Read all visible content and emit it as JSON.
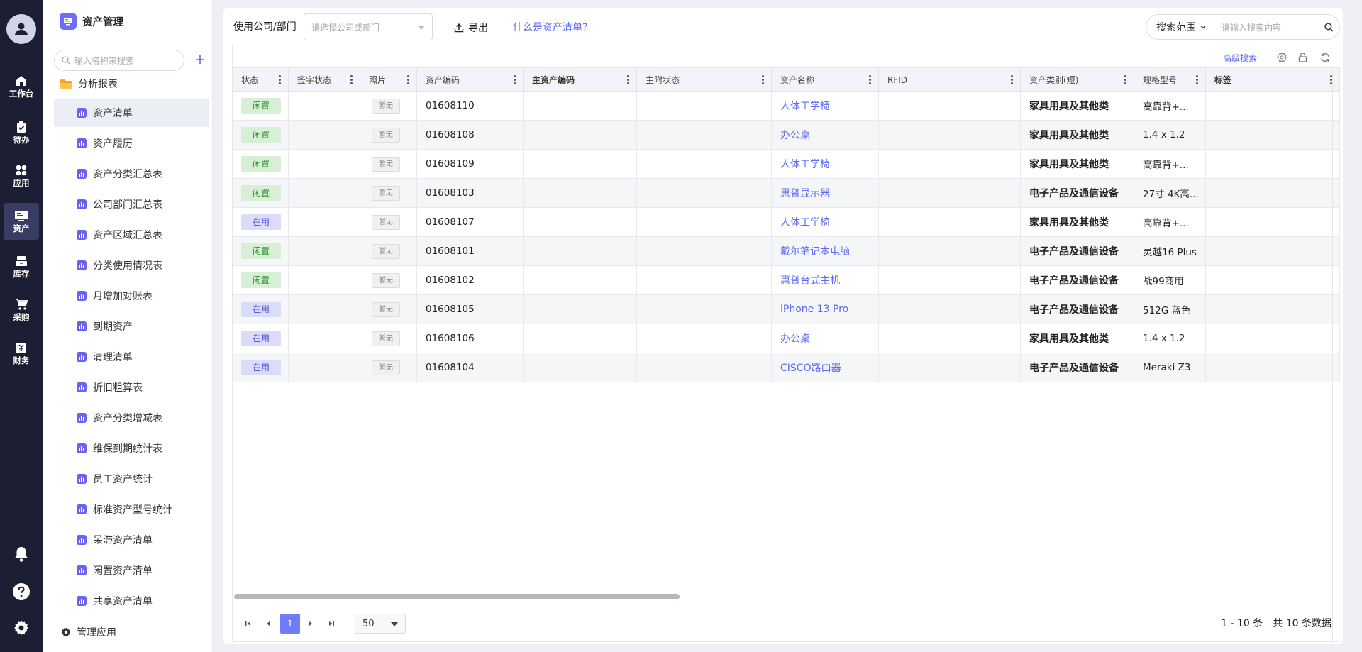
{
  "nav": {
    "items": [
      {
        "label": "工作台",
        "icon": "home-icon"
      },
      {
        "label": "待办",
        "icon": "clipboard-check-icon"
      },
      {
        "label": "应用",
        "icon": "grid-icon"
      },
      {
        "label": "资产",
        "icon": "asset-icon"
      },
      {
        "label": "库存",
        "icon": "inventory-icon"
      },
      {
        "label": "采购",
        "icon": "cart-icon"
      },
      {
        "label": "财务",
        "icon": "finance-icon"
      }
    ]
  },
  "sidebar": {
    "title": "资产管理",
    "search_placeholder": "输入名称来搜索",
    "folder": "分析报表",
    "items": [
      "资产清单",
      "资产履历",
      "资产分类汇总表",
      "公司部门汇总表",
      "资产区域汇总表",
      "分类使用情况表",
      "月增加对账表",
      "到期资产",
      "清理清单",
      "折旧粗算表",
      "资产分类增减表",
      "维保到期统计表",
      "员工资产统计",
      "标准资产型号统计",
      "呆滞资产清单",
      "闲置资产清单",
      "共享资产清单"
    ],
    "footer": "管理应用"
  },
  "filter": {
    "label": "使用公司/部门",
    "placeholder": "请选择公司或部门"
  },
  "export_label": "导出",
  "help_link": "什么是资产清单?",
  "search": {
    "scope": "搜索范围",
    "placeholder": "请输入搜索内容"
  },
  "toolbar": {
    "advanced_search": "高级搜索"
  },
  "table": {
    "columns": [
      "状态",
      "签字状态",
      "照片",
      "资产编码",
      "主资产编码",
      "主附状态",
      "资产名称",
      "RFID",
      "资产类别(短)",
      "规格型号",
      "标签"
    ],
    "rows": [
      {
        "status": "闲置",
        "photo": "暂无",
        "code": "01608110",
        "name": "人体工学椅",
        "category": "家具用具及其他类",
        "spec": "高靠背+..."
      },
      {
        "status": "闲置",
        "photo": "暂无",
        "code": "01608108",
        "name": "办公桌",
        "category": "家具用具及其他类",
        "spec": "1.4 x 1.2"
      },
      {
        "status": "闲置",
        "photo": "暂无",
        "code": "01608109",
        "name": "人体工学椅",
        "category": "家具用具及其他类",
        "spec": "高靠背+..."
      },
      {
        "status": "闲置",
        "photo": "暂无",
        "code": "01608103",
        "name": "惠普显示器",
        "category": "电子产品及通信设备",
        "spec": "27寸 4K高..."
      },
      {
        "status": "在用",
        "photo": "暂无",
        "code": "01608107",
        "name": "人体工学椅",
        "category": "家具用具及其他类",
        "spec": "高靠背+..."
      },
      {
        "status": "闲置",
        "photo": "暂无",
        "code": "01608101",
        "name": "戴尔笔记本电脑",
        "category": "电子产品及通信设备",
        "spec": "灵越16 Plus"
      },
      {
        "status": "闲置",
        "photo": "暂无",
        "code": "01608102",
        "name": "惠普台式主机",
        "category": "电子产品及通信设备",
        "spec": "战99商用"
      },
      {
        "status": "在用",
        "photo": "暂无",
        "code": "01608105",
        "name": "iPhone 13 Pro",
        "category": "电子产品及通信设备",
        "spec": "512G 蓝色"
      },
      {
        "status": "在用",
        "photo": "暂无",
        "code": "01608106",
        "name": "办公桌",
        "category": "家具用具及其他类",
        "spec": "1.4 x 1.2"
      },
      {
        "status": "在用",
        "photo": "暂无",
        "code": "01608104",
        "name": "CISCO路由器",
        "category": "电子产品及通信设备",
        "spec": "Meraki Z3"
      }
    ]
  },
  "pagination": {
    "current_page": "1",
    "page_size": "50",
    "range": "1 - 10 条",
    "total": "共 10 条数据"
  },
  "colors": {
    "accent": "#5b6af2",
    "nav_bg": "#1c1e33",
    "idle_badge": "#d7f0d5",
    "inuse_badge": "#dadcfa"
  }
}
